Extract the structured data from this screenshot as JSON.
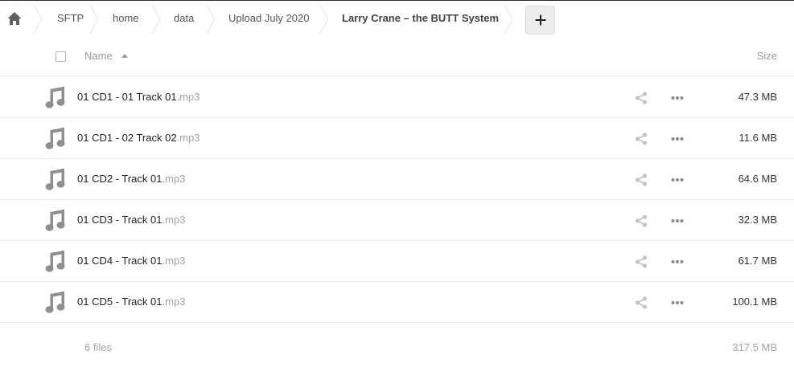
{
  "breadcrumb": {
    "home_icon": "home-icon",
    "items": [
      {
        "label": "SFTP"
      },
      {
        "label": "home"
      },
      {
        "label": "data"
      },
      {
        "label": "Upload July 2020"
      },
      {
        "label": "Larry Crane – the BUTT System"
      }
    ],
    "add_icon": "plus-icon"
  },
  "header": {
    "name_label": "Name",
    "size_label": "Size",
    "sort": "ascending"
  },
  "files": [
    {
      "base": "01 CD1 - 01 Track 01",
      "ext": ".mp3",
      "size": "47.3 MB",
      "icon": "music-note-icon"
    },
    {
      "base": "01 CD1 - 02 Track 02",
      "ext": ".mp3",
      "size": "11.6 MB",
      "icon": "music-note-icon"
    },
    {
      "base": "01 CD2 - Track 01",
      "ext": ".mp3",
      "size": "64.6 MB",
      "icon": "music-note-icon"
    },
    {
      "base": "01 CD3 - Track 01",
      "ext": ".mp3",
      "size": "32.3 MB",
      "icon": "music-note-icon"
    },
    {
      "base": "01 CD4 - Track 01",
      "ext": ".mp3",
      "size": "61.7 MB",
      "icon": "music-note-icon"
    },
    {
      "base": "01 CD5 - Track 01",
      "ext": ".mp3",
      "size": "100.1 MB",
      "icon": "music-note-icon"
    }
  ],
  "summary": {
    "count_label": "6 files",
    "total_size": "317.5 MB"
  },
  "colors": {
    "icon_gray": "#8f8f8f",
    "action_gray": "#c4c4c4",
    "separator": "#e6e6e6"
  }
}
